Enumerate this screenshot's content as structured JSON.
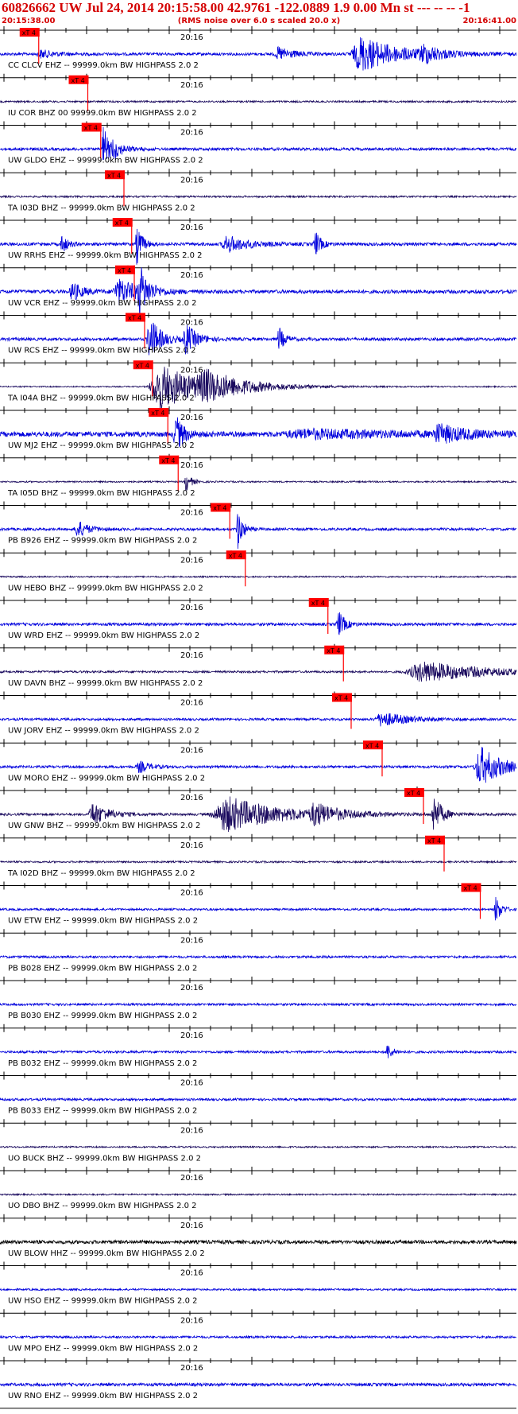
{
  "header": {
    "title": "60826662 UW Jul 24, 2014 20:15:58.00   42.9761 -122.0889  1.9 0.00 Mn st --- -- --  -1",
    "time_start": "20:15:38.00",
    "rms_note": "(RMS noise over 6.0 s scaled 20.0 x)",
    "time_end": "20:16:41.00"
  },
  "colors": {
    "title": "#d40000",
    "pick": "#ff0000",
    "trace_blue": "#0000dd",
    "trace_navy": "#1a0a5e",
    "trace_black": "#000000",
    "axis": "#000000"
  },
  "chart_data": {
    "type": "seismogram",
    "time_range": [
      "20:15:38.00",
      "20:16:41.00"
    ],
    "minute_tick_label": "20:16",
    "pick_label": "xT 4",
    "traces": [
      {
        "label": "CC CLCV EHZ -- 99999.0km BW  HIGHPASS  2.0  2",
        "pick": 0.075,
        "color": "blue",
        "amp": 0.55,
        "bursts": [
          [
            0.08,
            0.03,
            0.6
          ],
          [
            0.54,
            0.03,
            1.0
          ],
          [
            0.7,
            0.07,
            2.8
          ],
          [
            0.82,
            0.03,
            1.2
          ]
        ]
      },
      {
        "label": "IU COR BHZ 00 99999.0km BW  HIGHPASS  2.0  2",
        "pick": 0.17,
        "color": "navy",
        "amp": 0.35,
        "bursts": []
      },
      {
        "label": "UW GLDO EHZ -- 99999.0km BW  HIGHPASS  2.0  2",
        "pick": 0.195,
        "color": "blue",
        "amp": 0.55,
        "bursts": [
          [
            0.2,
            0.01,
            3.8
          ],
          [
            0.22,
            0.02,
            1.2
          ]
        ]
      },
      {
        "label": "TA I03D BHZ -- 99999.0km BW  HIGHPASS  2.0  2",
        "pick": 0.24,
        "color": "navy",
        "amp": 0.35,
        "bursts": []
      },
      {
        "label": "UW RRHS EHZ -- 99999.0km BW  HIGHPASS  2.0  2",
        "pick": 0.255,
        "color": "blue",
        "amp": 0.6,
        "bursts": [
          [
            0.12,
            0.01,
            1.6
          ],
          [
            0.265,
            0.01,
            3.2
          ],
          [
            0.44,
            0.04,
            1.3
          ],
          [
            0.61,
            0.01,
            2.2
          ]
        ]
      },
      {
        "label": "UW VCR EHZ -- 99999.0km BW  HIGHPASS  2.0  2",
        "pick": 0.26,
        "color": "blue",
        "amp": 0.7,
        "bursts": [
          [
            0.14,
            0.02,
            1.5
          ],
          [
            0.23,
            0.04,
            2.0
          ],
          [
            0.27,
            0.015,
            3.8
          ]
        ]
      },
      {
        "label": "UW RCS EHZ -- 99999.0km BW  HIGHPASS  2.0  2",
        "pick": 0.28,
        "color": "blue",
        "amp": 0.6,
        "bursts": [
          [
            0.29,
            0.02,
            3.6
          ],
          [
            0.36,
            0.02,
            2.4
          ],
          [
            0.54,
            0.01,
            2.0
          ]
        ]
      },
      {
        "label": "TA I04A BHZ -- 99999.0km BW  HIGHPASS  2.0  2",
        "pick": 0.295,
        "color": "navy",
        "amp": 0.25,
        "bursts": [
          [
            0.31,
            0.07,
            3.8
          ],
          [
            0.4,
            0.08,
            1.8
          ]
        ]
      },
      {
        "label": "UW MJ2 EHZ -- 99999.0km BW  HIGHPASS  2.0  2",
        "pick": 0.325,
        "color": "blue",
        "amp": 1.0,
        "bursts": [
          [
            0.34,
            0.015,
            3.0
          ],
          [
            0.6,
            0.2,
            0.6
          ],
          [
            0.85,
            0.05,
            1.3
          ]
        ]
      },
      {
        "label": "TA I05D BHZ -- 99999.0km BW  HIGHPASS  2.0  2",
        "pick": 0.345,
        "color": "navy",
        "amp": 0.3,
        "bursts": [
          [
            0.36,
            0.01,
            1.6
          ]
        ]
      },
      {
        "label": "PB B926 EHZ -- 99999.0km BW  HIGHPASS  2.0  2",
        "pick": 0.445,
        "color": "blue",
        "amp": 0.5,
        "bursts": [
          [
            0.15,
            0.02,
            1.4
          ],
          [
            0.46,
            0.01,
            3.2
          ]
        ]
      },
      {
        "label": "UW HEBO BHZ -- 99999.0km BW  HIGHPASS  2.0  2",
        "pick": 0.475,
        "color": "navy",
        "amp": 0.3,
        "bursts": []
      },
      {
        "label": "UW WRD EHZ -- 99999.0km BW  HIGHPASS  2.0  2",
        "pick": 0.635,
        "color": "blue",
        "amp": 0.55,
        "bursts": [
          [
            0.655,
            0.012,
            2.2
          ]
        ]
      },
      {
        "label": "UW DAVN BHZ -- 99999.0km BW  HIGHPASS  2.0  2",
        "pick": 0.665,
        "color": "navy",
        "amp": 0.4,
        "bursts": [
          [
            0.82,
            0.12,
            1.6
          ]
        ]
      },
      {
        "label": "UW JORV EHZ -- 99999.0km BW  HIGHPASS  2.0  2",
        "pick": 0.68,
        "color": "blue",
        "amp": 0.45,
        "bursts": [
          [
            0.74,
            0.05,
            1.1
          ]
        ]
      },
      {
        "label": "UW MORO EHZ -- 99999.0km BW  HIGHPASS  2.0  2",
        "pick": 0.74,
        "color": "blue",
        "amp": 0.5,
        "bursts": [
          [
            0.27,
            0.02,
            0.9
          ],
          [
            0.93,
            0.04,
            3.2
          ]
        ]
      },
      {
        "label": "UW GNW BHZ -- 99999.0km BW  HIGHPASS  2.0  2",
        "pick": 0.82,
        "color": "navy",
        "amp": 0.45,
        "bursts": [
          [
            0.18,
            0.03,
            1.8
          ],
          [
            0.44,
            0.1,
            2.8
          ],
          [
            0.61,
            0.04,
            1.5
          ],
          [
            0.84,
            0.015,
            3.2
          ]
        ]
      },
      {
        "label": "TA I02D BHZ -- 99999.0km BW  HIGHPASS  2.0  2",
        "pick": 0.86,
        "color": "navy",
        "amp": 0.35,
        "bursts": []
      },
      {
        "label": "UW ETW EHZ -- 99999.0km BW  HIGHPASS  2.0  2",
        "pick": 0.93,
        "color": "blue",
        "amp": 0.4,
        "bursts": [
          [
            0.96,
            0.01,
            2.2
          ]
        ]
      },
      {
        "label": "PB B028 EHZ -- 99999.0km BW  HIGHPASS  2.0  2",
        "pick": null,
        "color": "blue",
        "amp": 0.45,
        "bursts": []
      },
      {
        "label": "PB B030 EHZ -- 99999.0km BW  HIGHPASS  2.0  2",
        "pick": null,
        "color": "blue",
        "amp": 0.45,
        "bursts": []
      },
      {
        "label": "PB B032 EHZ -- 99999.0km BW  HIGHPASS  2.0  2",
        "pick": null,
        "color": "blue",
        "amp": 0.45,
        "bursts": [
          [
            0.75,
            0.01,
            1.3
          ]
        ]
      },
      {
        "label": "PB B033 EHZ -- 99999.0km BW  HIGHPASS  2.0  2",
        "pick": null,
        "color": "blue",
        "amp": 0.45,
        "bursts": []
      },
      {
        "label": "UO BUCK BHZ -- 99999.0km BW  HIGHPASS  2.0  2",
        "pick": null,
        "color": "navy",
        "amp": 0.3,
        "bursts": []
      },
      {
        "label": "UO DBO BHZ -- 99999.0km BW  HIGHPASS  2.0  2",
        "pick": null,
        "color": "navy",
        "amp": 0.3,
        "bursts": []
      },
      {
        "label": "UW BLOW HHZ -- 99999.0km BW  HIGHPASS  2.0  2",
        "pick": null,
        "color": "black",
        "amp": 0.7,
        "bursts": []
      },
      {
        "label": "UW HSO EHZ -- 99999.0km BW  HIGHPASS  2.0  2",
        "pick": null,
        "color": "blue",
        "amp": 0.35,
        "bursts": []
      },
      {
        "label": "UW MPO EHZ -- 99999.0km BW  HIGHPASS  2.0  2",
        "pick": null,
        "color": "blue",
        "amp": 0.45,
        "bursts": []
      },
      {
        "label": "UW RNO EHZ -- 99999.0km BW  HIGHPASS  2.0  2",
        "pick": null,
        "color": "blue",
        "amp": 0.6,
        "bursts": []
      }
    ]
  }
}
